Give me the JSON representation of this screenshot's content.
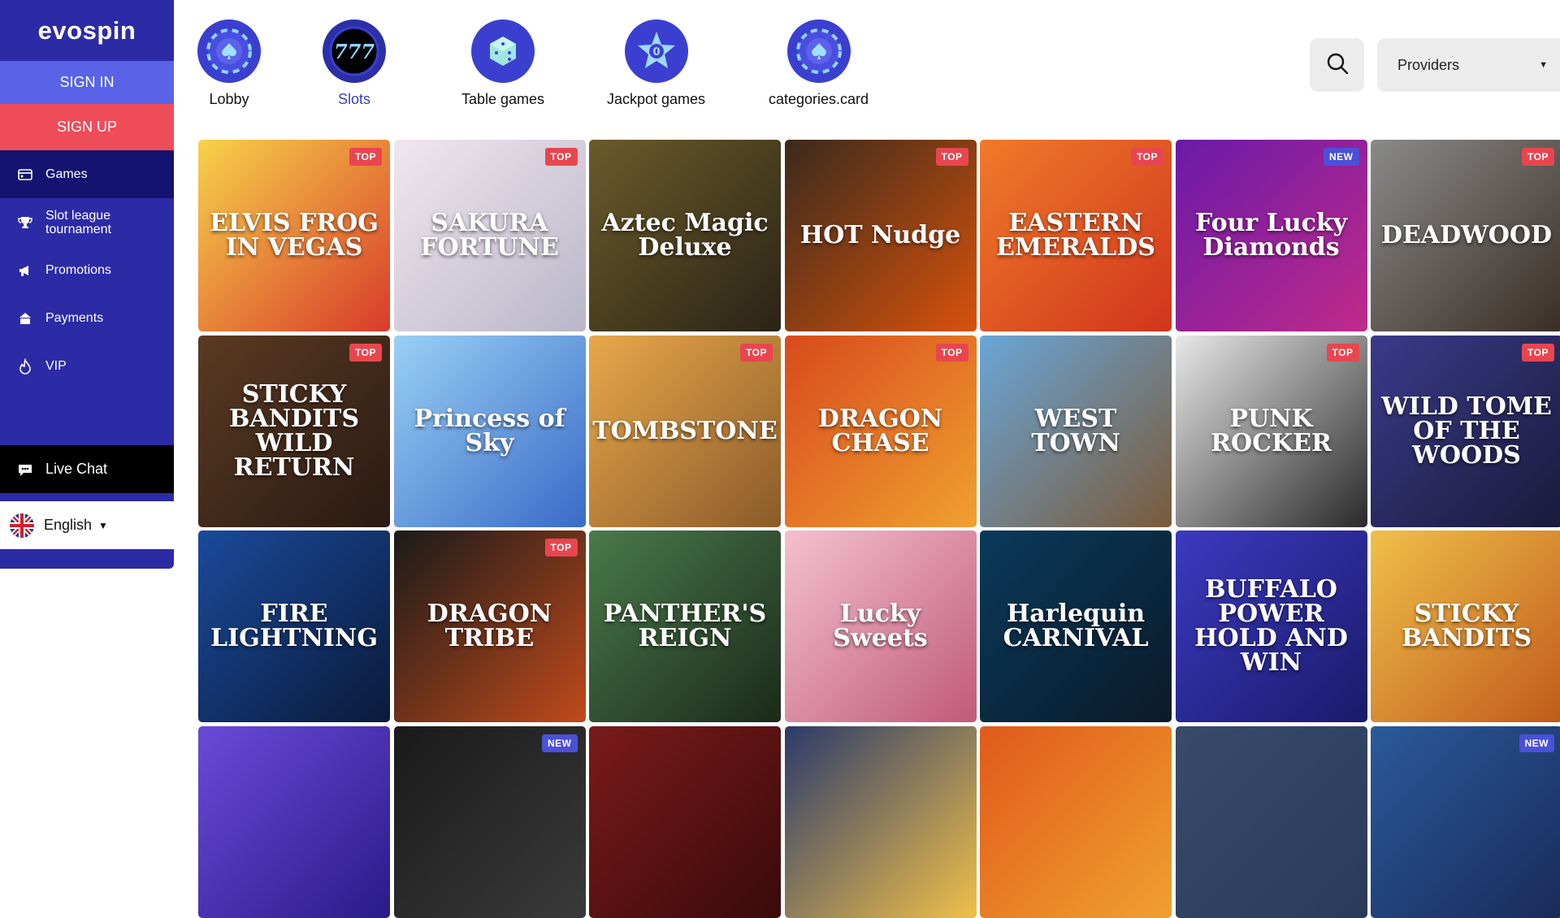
{
  "sidebar": {
    "logo": "evospin",
    "sign_in": "SIGN IN",
    "sign_up": "SIGN UP",
    "items": [
      {
        "label": "Games"
      },
      {
        "label": "Slot league tournament"
      },
      {
        "label": "Promotions"
      },
      {
        "label": "Payments"
      },
      {
        "label": "VIP"
      }
    ],
    "live_chat": "Live Chat",
    "language": "English"
  },
  "categories": [
    {
      "label": "Lobby"
    },
    {
      "label": "Slots"
    },
    {
      "label": "Table games"
    },
    {
      "label": "Jackpot games"
    },
    {
      "label": "categories.card"
    }
  ],
  "providers": {
    "label": "Providers"
  },
  "games": [
    {
      "name": "ELVIS FROG IN VEGAS",
      "badge": "TOP"
    },
    {
      "name": "SAKURA FORTUNE",
      "badge": "TOP"
    },
    {
      "name": "Aztec Magic Deluxe",
      "badge": ""
    },
    {
      "name": "HOT Nudge",
      "badge": "TOP"
    },
    {
      "name": "EASTERN EMERALDS",
      "badge": "TOP"
    },
    {
      "name": "Four Lucky Diamonds",
      "badge": "NEW"
    },
    {
      "name": "DEADWOOD",
      "badge": "TOP"
    },
    {
      "name": "STICKY BANDITS WILD RETURN",
      "badge": "TOP"
    },
    {
      "name": "Princess of Sky",
      "badge": ""
    },
    {
      "name": "TOMBSTONE",
      "badge": "TOP"
    },
    {
      "name": "DRAGON CHASE",
      "badge": "TOP"
    },
    {
      "name": "WEST TOWN",
      "badge": ""
    },
    {
      "name": "PUNK ROCKER",
      "badge": "TOP"
    },
    {
      "name": "WILD TOME OF THE WOODS",
      "badge": "TOP"
    },
    {
      "name": "FIRE LIGHTNING",
      "badge": ""
    },
    {
      "name": "DRAGON TRIBE",
      "badge": "TOP"
    },
    {
      "name": "PANTHER'S REIGN",
      "badge": ""
    },
    {
      "name": "Lucky Sweets",
      "badge": ""
    },
    {
      "name": "Harlequin CARNIVAL",
      "badge": ""
    },
    {
      "name": "BUFFALO POWER HOLD AND WIN",
      "badge": ""
    },
    {
      "name": "STICKY BANDITS",
      "badge": ""
    },
    {
      "name": "",
      "badge": ""
    },
    {
      "name": "",
      "badge": "NEW"
    },
    {
      "name": "",
      "badge": ""
    },
    {
      "name": "",
      "badge": ""
    },
    {
      "name": "",
      "badge": ""
    },
    {
      "name": "",
      "badge": ""
    },
    {
      "name": "",
      "badge": "NEW"
    }
  ],
  "colors": {
    "sidebar": "#2c2ba6",
    "sign_in": "#5a63e8",
    "sign_up": "#ee4d59",
    "badge_top": "#e8464f",
    "badge_new": "#4b50d8"
  }
}
